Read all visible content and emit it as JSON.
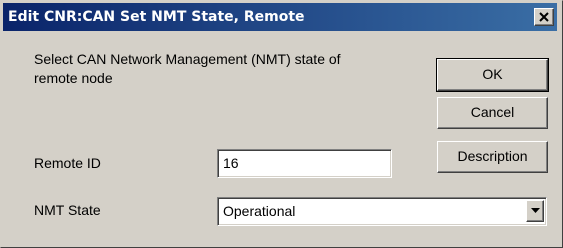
{
  "window": {
    "title": "Edit CNR:CAN Set NMT State, Remote"
  },
  "prompt": {
    "text": "Select CAN Network Management (NMT) state of remote node"
  },
  "buttons": {
    "ok_label": "OK",
    "cancel_label": "Cancel",
    "description_label": "Description"
  },
  "remote_id": {
    "label": "Remote ID",
    "value": "16"
  },
  "nmt_state": {
    "label": "NMT State",
    "selected": "Operational"
  },
  "icons": {
    "close": "close-icon",
    "dropdown": "chevron-down-icon"
  },
  "colors": {
    "titlebar_start": "#0a246a",
    "titlebar_end": "#3a6ea5",
    "dialog_face": "#d4d0c8"
  }
}
